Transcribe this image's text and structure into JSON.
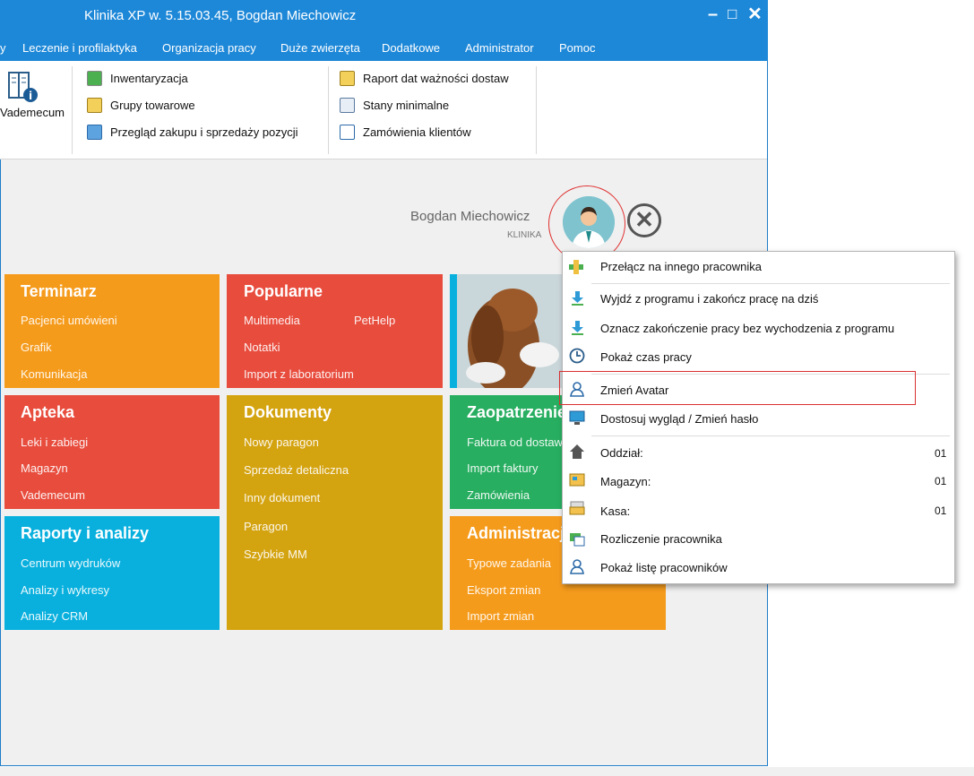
{
  "window": {
    "title": "Klinika XP w. 5.15.03.45, Bogdan Miechowicz",
    "minimize": "–",
    "maximize": "□",
    "close": "✕"
  },
  "menu": [
    "y",
    "Leczenie i profilaktyka",
    "Organizacja pracy",
    "Duże zwierzęta",
    "Dodatkowe",
    "Administrator",
    "Pomoc"
  ],
  "ribbon": {
    "vademecum": "Vademecum",
    "col1": [
      "Inwentaryzacja",
      "Grupy towarowe",
      "Przegląd zakupu i sprzedaży pozycji"
    ],
    "col2": [
      "Raport dat ważności dostaw",
      "Stany minimalne",
      "Zamówienia klientów"
    ]
  },
  "user": {
    "name": "Bogdan Miechowicz",
    "subtitle": "KLINIKA"
  },
  "tiles": {
    "terminarz": {
      "title": "Terminarz",
      "links": [
        "Pacjenci umówieni",
        "Grafik",
        "Komunikacja"
      ]
    },
    "popularne": {
      "title": "Popularne",
      "links": [
        "Multimedia",
        "PetHelp",
        "Notatki",
        "Import z laboratorium"
      ]
    },
    "apteka": {
      "title": "Apteka",
      "links": [
        "Leki i zabiegi",
        "Magazyn",
        "Vademecum"
      ]
    },
    "dokumenty": {
      "title": "Dokumenty",
      "links": [
        "Nowy paragon",
        "Sprzedaż detaliczna",
        "Inny dokument",
        "Paragon",
        "Szybkie MM"
      ]
    },
    "zaopatrzenie": {
      "title": "Zaopatrzenie",
      "links": [
        "Faktura od dostawcy",
        "Import faktury",
        "Zamówienia"
      ]
    },
    "raporty": {
      "title": "Raporty i analizy",
      "links": [
        "Centrum wydruków",
        "Analizy i wykresy",
        "Analizy CRM"
      ]
    },
    "administracja": {
      "title": "Administracja",
      "links": [
        "Typowe zadania",
        "Eksport zmian",
        "Import zmian"
      ]
    }
  },
  "popup": {
    "items": [
      {
        "label": "Przełącz na innego pracownika"
      },
      {
        "label": "Wyjdź z programu i zakończ pracę na dziś"
      },
      {
        "label": "Oznacz zakończenie pracy bez wychodzenia z programu"
      },
      {
        "label": "Pokaż czas pracy"
      },
      {
        "label": "Zmień Avatar"
      },
      {
        "label": "Dostosuj wygląd / Zmień hasło"
      },
      {
        "label": "Oddział:",
        "value": "01"
      },
      {
        "label": "Magazyn:",
        "value": "01"
      },
      {
        "label": "Kasa:",
        "value": "01"
      },
      {
        "label": "Rozliczenie pracownika"
      },
      {
        "label": "Pokaż listę pracowników"
      }
    ]
  },
  "colors": {
    "titlebar": "#1e88d8",
    "orange": "#f59b1c",
    "red": "#e84c3d",
    "mustard": "#d4a310",
    "green": "#27ae60",
    "cyan": "#09b0de",
    "highlight": "#d93030"
  }
}
